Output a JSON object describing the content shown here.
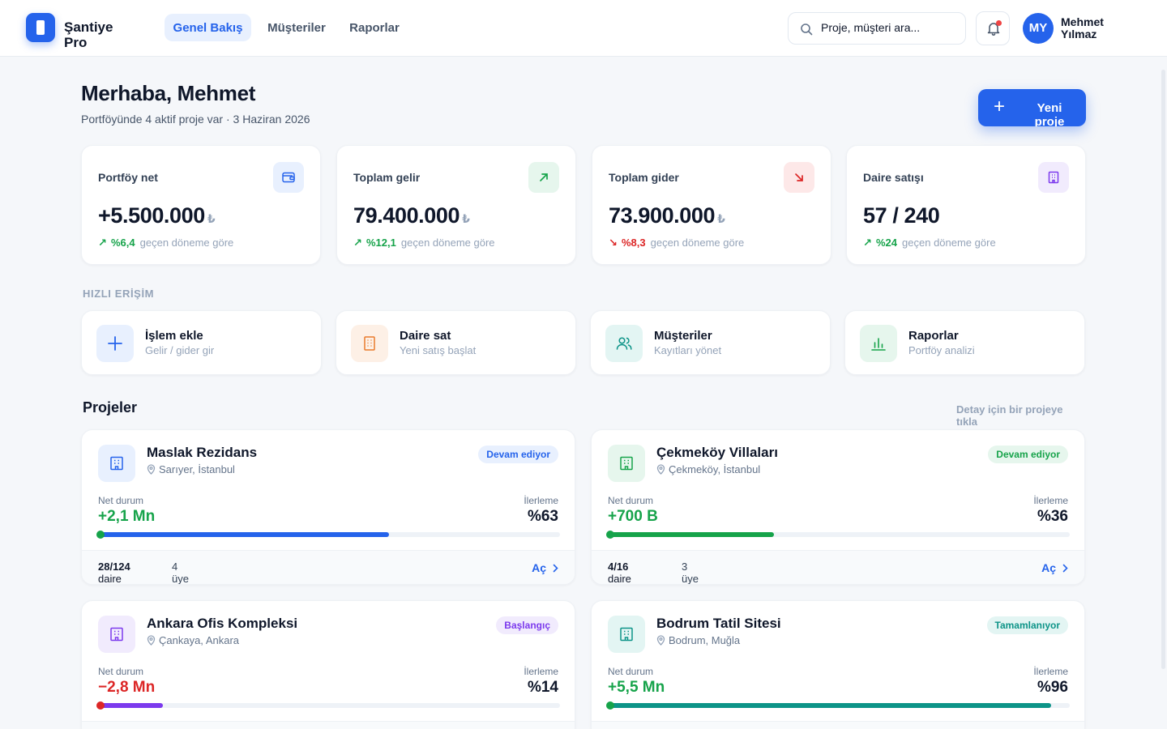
{
  "app": {
    "name": "Şantiye Pro"
  },
  "nav": {
    "items": [
      {
        "label": "Genel Bakış",
        "active": true
      },
      {
        "label": "Müşteriler",
        "active": false
      },
      {
        "label": "Raporlar",
        "active": false
      }
    ]
  },
  "search": {
    "placeholder": "Proje, müşteri ara..."
  },
  "notifications": {
    "has_unread": true
  },
  "user": {
    "initials": "MY",
    "name": "Mehmet Yılmaz"
  },
  "greeting": {
    "title": "Merhaba, Mehmet",
    "subtitle": "Portföyünde 4 aktif proje var · 3 Haziran 2026"
  },
  "new_project_button": "Yeni proje",
  "stats": [
    {
      "label": "Portföy net",
      "value": "+5.500.000",
      "currency": "₺",
      "trend": "up",
      "delta": "%6,4",
      "delta_text": "geçen döneme göre",
      "icon": "wallet-icon",
      "accent": "#2563eb"
    },
    {
      "label": "Toplam gelir",
      "value": "79.400.000",
      "currency": "₺",
      "trend": "up",
      "delta": "%12,1",
      "delta_text": "geçen döneme göre",
      "icon": "arrow-up-right-icon",
      "accent": "#16a34a"
    },
    {
      "label": "Toplam gider",
      "value": "73.900.000",
      "currency": "₺",
      "trend": "down",
      "delta": "%8,3",
      "delta_text": "geçen döneme göre",
      "icon": "arrow-down-right-icon",
      "accent": "#dc2626"
    },
    {
      "label": "Daire satışı",
      "value": "57 / 240",
      "currency": "",
      "trend": "up",
      "delta": "%24",
      "delta_text": "geçen döneme göre",
      "icon": "building-icon",
      "accent": "#7c3aed"
    }
  ],
  "quick_access": {
    "title": "HIZLI ERİŞİM",
    "items": [
      {
        "title": "İşlem ekle",
        "subtitle": "Gelir / gider gir",
        "icon": "plus-icon",
        "accent": "#2563eb"
      },
      {
        "title": "Daire sat",
        "subtitle": "Yeni satış başlat",
        "icon": "building-icon",
        "accent": "#ea7a2c"
      },
      {
        "title": "Müşteriler",
        "subtitle": "Kayıtları yönet",
        "icon": "users-icon",
        "accent": "#0d9488"
      },
      {
        "title": "Raporlar",
        "subtitle": "Portföy analizi",
        "icon": "bar-chart-icon",
        "accent": "#16a34a"
      }
    ]
  },
  "projects": {
    "title": "Projeler",
    "hint": "Detay için bir projeye tıkla",
    "net_label": "Net durum",
    "progress_label": "İlerleme",
    "units_label": "daire",
    "members_label": "üye",
    "open_label": "Aç",
    "items": [
      {
        "name": "Maslak Rezidans",
        "location": "Sarıyer, İstanbul",
        "status": "Devam ediyor",
        "status_color": "#2563eb",
        "net": "+2,1 Mn",
        "net_trend": "up",
        "progress_text": "%63",
        "progress": 0.63,
        "units": "28/124",
        "members": "4",
        "accent": "#2563eb"
      },
      {
        "name": "Çekmeköy Villaları",
        "location": "Çekmeköy, İstanbul",
        "status": "Devam ediyor",
        "status_color": "#16a34a",
        "net": "+700 B",
        "net_trend": "up",
        "progress_text": "%36",
        "progress": 0.36,
        "units": "4/16",
        "members": "3",
        "accent": "#16a34a"
      },
      {
        "name": "Ankara Ofis Kompleksi",
        "location": "Çankaya, Ankara",
        "status": "Başlangıç",
        "status_color": "#7c3aed",
        "net": "−2,8 Mn",
        "net_trend": "down",
        "progress_text": "%14",
        "progress": 0.14,
        "units": "",
        "members": "",
        "accent": "#7c3aed"
      },
      {
        "name": "Bodrum Tatil Sitesi",
        "location": "Bodrum, Muğla",
        "status": "Tamamlanıyor",
        "status_color": "#0d9488",
        "net": "+5,5 Mn",
        "net_trend": "up",
        "progress_text": "%96",
        "progress": 0.96,
        "units": "",
        "members": "",
        "accent": "#0d9488"
      }
    ]
  }
}
